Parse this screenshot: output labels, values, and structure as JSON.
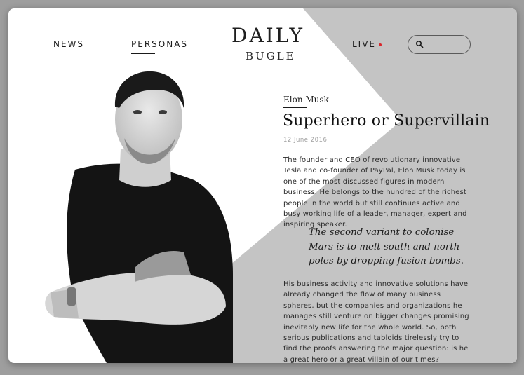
{
  "header": {
    "nav": {
      "news": "NEWS",
      "personas": "PERSONAS",
      "live": "LIVE"
    },
    "logo": {
      "line1": "DAILY",
      "line2": "BUGLE"
    },
    "live_dot_color": "#d9262b",
    "search_icon": "search-icon"
  },
  "article": {
    "persona": "Elon Musk",
    "title": "Superhero or Supervillain",
    "date": "12 June 2016",
    "paragraph1": "The founder and CEO of revolutionary innovative Tesla and co-founder of PayPal, Elon Musk today is one of the most discussed figures in modern business. He belongs to the hundred of the richest people in the world but still continues active and busy working life of a leader, manager, expert and inspiring speaker.",
    "quote": [
      "The second variant to colonise",
      "Mars is to melt south and north",
      "poles by dropping fusion bombs."
    ],
    "paragraph2": "His business activity and innovative solutions have already changed the flow of many business spheres, but the companies and organizations he manages still venture on bigger changes promising inevitably new life for the whole world. So, both serious publications and tabloids tirelessly try to find the proofs answering the major question: is he a great hero or a great villain of our times?"
  },
  "colors": {
    "panel_gray": "#c4c4c4",
    "background": "#9e9e9e"
  }
}
